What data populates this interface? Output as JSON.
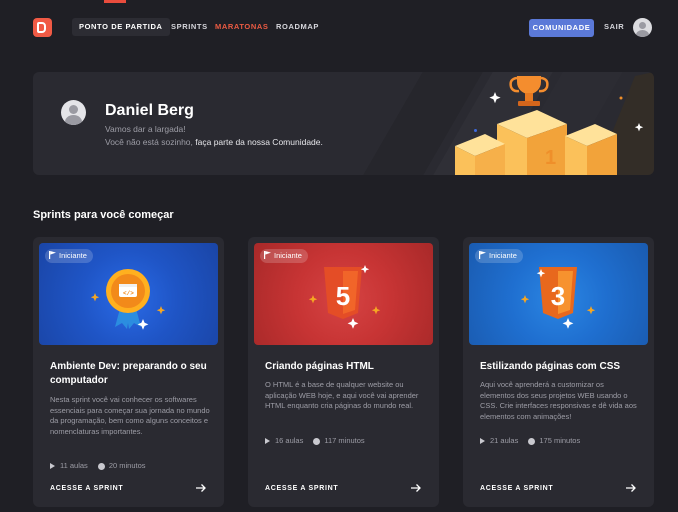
{
  "nav": {
    "items": [
      "PONTO DE PARTIDA",
      "SPRINTS",
      "MARATONAS",
      "ROADMAP"
    ],
    "community_button": "COMUNIDADE",
    "logout": "SAIR"
  },
  "profile": {
    "name": "Daniel Berg",
    "greeting": "Vamos dar a largada!",
    "message_prefix": "Você não está sozinho,",
    "message_highlight": "faça parte da nossa Comunidade.",
    "trophy_rank": "1"
  },
  "section": {
    "title": "Sprints para você começar"
  },
  "cards": [
    {
      "badge": "Iniciante",
      "title": "Ambiente Dev: preparando o seu computador",
      "description": "Nesta sprint você vai conhecer os softwares essenciais para começar sua jornada no mundo da programação, bem como alguns conceitos e nomenclaturas importantes.",
      "lessons": "11 aulas",
      "duration": "20 minutos",
      "cta": "ACESSE A SPRINT",
      "icon": "code-window-icon",
      "color": "#1f55c6"
    },
    {
      "badge": "Iniciante",
      "title": "Criando páginas HTML",
      "description": "O HTML é a base de qualquer website ou aplicação WEB hoje, e aqui você vai aprender HTML enquanto cria páginas do mundo real.",
      "lessons": "16 aulas",
      "duration": "117 minutos",
      "cta": "ACESSE A SPRINT",
      "icon": "html5-icon",
      "shield_text": "5",
      "color": "#cc3535"
    },
    {
      "badge": "Iniciante",
      "title": "Estilizando páginas com CSS",
      "description": "Aqui você aprenderá a customizar os elementos dos seus projetos WEB usando o CSS. Crie interfaces responsivas e dê vida aos elementos com animações!",
      "lessons": "21 aulas",
      "duration": "175 minutos",
      "cta": "ACESSE A SPRINT",
      "icon": "css3-icon",
      "shield_text": "3",
      "color": "#1f6fd0"
    }
  ]
}
